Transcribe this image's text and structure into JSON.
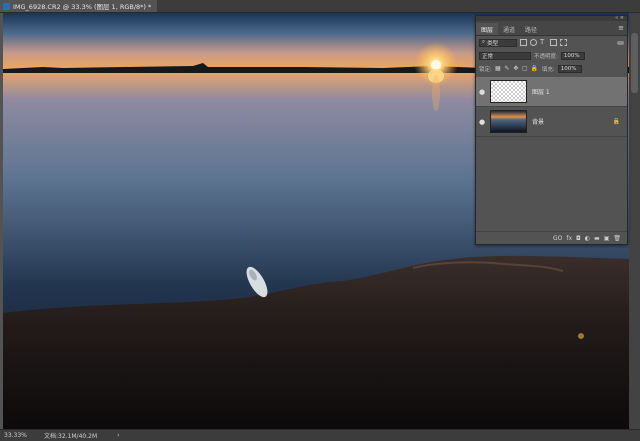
{
  "document": {
    "tab_title": "IMG_6928.CR2 @ 33.3% (图层 1, RGB/8*) *"
  },
  "status": {
    "zoom": "33.33%",
    "doc_info": "文档:32.1M/40.2M",
    "arrow": "›"
  },
  "panel": {
    "top_icons": "« ×",
    "menu_icon": "≡",
    "tabs": [
      {
        "label": "图层"
      },
      {
        "label": "通道"
      },
      {
        "label": "路径"
      }
    ],
    "filter": {
      "kind_value": "类型"
    },
    "blend_mode": "正常",
    "opacity_label": "不透明度:",
    "opacity_value": "100%",
    "lock_label": "锁定:",
    "fill_label": "填充:",
    "fill_value": "100%",
    "layers": [
      {
        "name": "图层 1",
        "visible_icon": "●",
        "selected": true
      },
      {
        "name": "背景",
        "visible_icon": "●",
        "locked_icon": "🔒"
      }
    ],
    "bottom_icons": [
      "GO",
      "fx",
      "◘",
      "◐",
      "▬",
      "▣",
      "🗑"
    ]
  },
  "colors": {
    "app_bg": "#535353",
    "panel_bg": "#535353",
    "selected_layer": "#727272",
    "sunset_orange": "#f0a040"
  }
}
